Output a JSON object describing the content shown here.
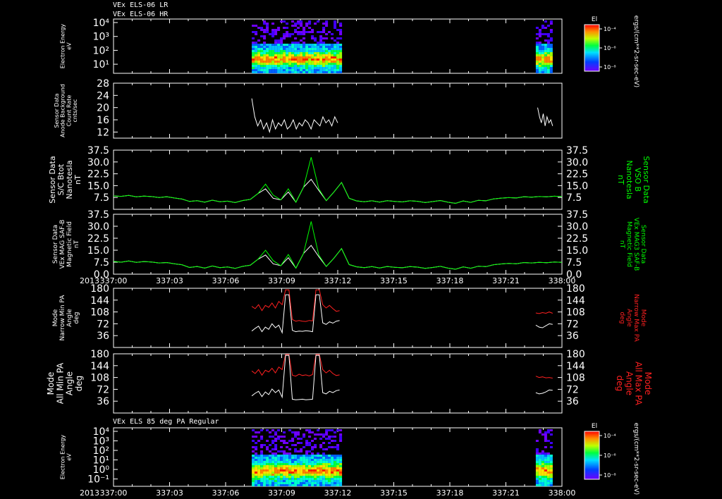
{
  "header": {
    "title_lines": [
      "VEx ELS-06 LR",
      "VEx ELS-06 HR"
    ]
  },
  "bottom_panel_title": "VEx ELS 85 deg PA Regular",
  "colors": {
    "white": "#ffffff",
    "green": "#00ff00",
    "red": "#ff2020",
    "frame": "#ffffff"
  },
  "colorbars": [
    {
      "label": "El",
      "ticks": [
        "10⁻⁴",
        "10⁻⁶",
        "10⁻⁸"
      ],
      "unit": "ergs/(cm**2-sr-sec-eV)"
    },
    {
      "label": "El",
      "ticks": [
        "10⁻⁴",
        "10⁻⁶",
        "10⁻⁸"
      ],
      "unit": "ergs/(cm**2-sr-sec-eV)"
    }
  ],
  "chart_data": [
    {
      "type": "heatmap",
      "ylabel": [
        "Electron Energy",
        "eV"
      ],
      "yticks": [
        "10⁴",
        "10³",
        "10²",
        "10¹"
      ],
      "scale": "log",
      "blocks": [
        {
          "t0": 7.4,
          "t1": 12.1
        },
        {
          "t0": 22.6,
          "t1": 23.5
        }
      ]
    },
    {
      "type": "line",
      "ylabel": [
        "Sensor Data",
        "Anode Background",
        "Count Rate",
        "cnts/sec"
      ],
      "yticks": [
        "28",
        "24",
        "20",
        "16",
        "12"
      ],
      "ylim": [
        10,
        28
      ],
      "series": [
        {
          "color": "white",
          "segments": [
            {
              "t0": 7.4,
              "t1": 12.0,
              "values": [
                23,
                17,
                14,
                16,
                13,
                15,
                12,
                16,
                13,
                15,
                14,
                16,
                13,
                14,
                16,
                13,
                15,
                14,
                16,
                15,
                13,
                16,
                15,
                14,
                17,
                15,
                16,
                14,
                17,
                15
              ]
            },
            {
              "t0": 22.7,
              "t1": 23.5,
              "values": [
                20,
                17,
                15,
                18,
                14,
                17,
                15,
                16,
                14
              ]
            }
          ]
        }
      ]
    },
    {
      "type": "line",
      "ylabel": [
        "Sensor Data",
        "S/C Btot",
        "Nanotesla",
        "nT"
      ],
      "ylabel_right": [
        "Sensor Data",
        "VSO B",
        "Nanotesla",
        "nT"
      ],
      "yticks": [
        "37.5",
        "30.0",
        "22.5",
        "15.0",
        "7.5"
      ],
      "ylim": [
        0,
        37.5
      ],
      "series": [
        {
          "color": "white",
          "values": [
            8.5,
            8.2,
            8.8,
            7.9,
            8.4,
            8.1,
            7.5,
            8,
            7.2,
            6.5,
            5,
            5.5,
            4.5,
            5.8,
            4.8,
            5.2,
            4.3,
            5.6,
            6.3,
            10,
            13,
            7,
            6,
            11,
            4.5,
            14,
            19,
            12,
            5.5,
            11,
            17,
            7,
            5.3,
            4.8,
            5.4,
            4.6,
            5.5,
            5,
            4.7,
            5.4,
            5.1,
            4.3,
            4.9,
            5.6,
            4.5,
            3.8,
            5.3,
            4.4,
            5.7,
            5.4,
            6.6,
            7.1,
            7.4,
            7.2,
            8,
            7.7,
            8.1,
            7.9,
            8.3,
            8.1
          ]
        },
        {
          "color": "green",
          "values": [
            8.5,
            8.2,
            8.8,
            7.9,
            8.4,
            8.1,
            7.5,
            8,
            7.2,
            6.5,
            5,
            5.5,
            4.5,
            5.8,
            4.8,
            5.2,
            4.3,
            5.6,
            6.3,
            10,
            16,
            9,
            6,
            13,
            4.5,
            14,
            33,
            13,
            5.5,
            11,
            17,
            7,
            5.3,
            4.8,
            5.4,
            4.6,
            5.5,
            5,
            4.7,
            5.4,
            5.1,
            4.3,
            4.9,
            5.6,
            4.5,
            3.8,
            5.3,
            4.4,
            5.7,
            5.4,
            6.6,
            7.1,
            7.4,
            7.2,
            8,
            7.7,
            8.1,
            7.9,
            8.3,
            8.1
          ]
        }
      ]
    },
    {
      "type": "line",
      "ylabel": [
        "Sensor Data",
        "VEx MAG SAF-B",
        "Magnetic Field",
        "nT"
      ],
      "ylabel_right": [
        "Sensor Data",
        "VEx MAG3 SAF-B",
        "Magnetic Field",
        "nT"
      ],
      "yticks": [
        "37.5",
        "30.0",
        "22.5",
        "15.0",
        "7.5",
        "0.0"
      ],
      "ylim": [
        0,
        37.5
      ],
      "series": [
        {
          "color": "white",
          "values": [
            8,
            7.5,
            8.3,
            7.4,
            7.9,
            7.6,
            7,
            7.3,
            6.5,
            5.9,
            4.2,
            4.8,
            3.8,
            5.1,
            4.1,
            4.5,
            3.6,
            4.9,
            5.6,
            9.3,
            12,
            6.5,
            5.3,
            10.3,
            3.8,
            13,
            18,
            11,
            4.8,
            10,
            16,
            6,
            4.6,
            4.1,
            4.7,
            3.9,
            4.8,
            4.3,
            4,
            4.7,
            4.4,
            3.6,
            4.2,
            4.9,
            3.8,
            3.1,
            4.6,
            3.7,
            5,
            4.7,
            5.9,
            6.4,
            6.7,
            6.5,
            7.3,
            7,
            7.4,
            7.2,
            7.6,
            7.4
          ]
        },
        {
          "color": "green",
          "values": [
            8,
            7.5,
            8.3,
            7.4,
            7.9,
            7.6,
            7,
            7.3,
            6.5,
            5.9,
            4.2,
            4.8,
            3.8,
            5.1,
            4.1,
            4.5,
            3.6,
            4.9,
            5.6,
            9.3,
            15,
            8.5,
            5.3,
            12.3,
            3.8,
            13,
            33,
            12,
            4.8,
            10,
            16,
            6,
            4.6,
            4.1,
            4.7,
            3.9,
            4.8,
            4.3,
            4,
            4.7,
            4.4,
            3.6,
            4.2,
            4.9,
            3.8,
            3.1,
            4.6,
            3.7,
            5,
            4.7,
            5.9,
            6.4,
            6.7,
            6.5,
            7.3,
            7,
            7.4,
            7.2,
            7.6,
            7.4
          ]
        }
      ]
    },
    {
      "type": "line",
      "ylabel": [
        "Mode",
        "Narrow Min PA",
        "Angle",
        "deg"
      ],
      "ylabel_right": [
        "Mode",
        "Narrow Max PA",
        "Angle",
        "deg"
      ],
      "yticks": [
        "180",
        "144",
        "108",
        "72",
        "36"
      ],
      "ylim": [
        0,
        180
      ],
      "series": [
        {
          "color": "red",
          "segments": [
            {
              "t0": 7.4,
              "t1": 12.1,
              "values": [
                125,
                118,
                130,
                112,
                128,
                122,
                135,
                120,
                140,
                130,
                175,
                175,
                85,
                80,
                82,
                80,
                79,
                82,
                81,
                175,
                175,
                130,
                120,
                128,
                118,
                110,
                112
              ]
            },
            {
              "t0": 22.6,
              "t1": 23.5,
              "values": [
                105,
                103,
                106,
                104,
                108,
                104
              ]
            }
          ]
        },
        {
          "color": "white",
          "segments": [
            {
              "t0": 7.4,
              "t1": 12.1,
              "values": [
                50,
                58,
                65,
                48,
                62,
                55,
                72,
                60,
                68,
                45,
                160,
                160,
                52,
                48,
                50,
                49,
                51,
                50,
                48,
                160,
                160,
                75,
                70,
                78,
                74,
                80,
                82
              ]
            },
            {
              "t0": 22.6,
              "t1": 23.5,
              "values": [
                68,
                62,
                60,
                66,
                72,
                70
              ]
            }
          ]
        }
      ]
    },
    {
      "type": "line",
      "ylabel": [
        "Mode",
        "All Min PA",
        "Angle",
        "deg"
      ],
      "ylabel_right": [
        "Mode",
        "All Max PA",
        "Angle",
        "deg"
      ],
      "yticks": [
        "180",
        "144",
        "108",
        "72",
        "36"
      ],
      "ylim": [
        0,
        180
      ],
      "series": [
        {
          "color": "red",
          "segments": [
            {
              "t0": 7.4,
              "t1": 12.1,
              "values": [
                128,
                120,
                132,
                115,
                130,
                125,
                136,
                122,
                140,
                132,
                178,
                178,
                115,
                112,
                118,
                114,
                116,
                113,
                117,
                178,
                178,
                132,
                122,
                130,
                120,
                114,
                116
              ]
            },
            {
              "t0": 22.6,
              "t1": 23.5,
              "values": [
                112,
                108,
                110,
                107,
                108,
                106
              ]
            }
          ]
        },
        {
          "color": "white",
          "segments": [
            {
              "t0": 7.4,
              "t1": 12.1,
              "values": [
                52,
                60,
                66,
                50,
                64,
                56,
                73,
                62,
                70,
                48,
                175,
                175,
                42,
                40,
                41,
                42,
                40,
                41,
                42,
                175,
                175,
                62,
                58,
                66,
                62,
                68,
                70
              ]
            },
            {
              "t0": 22.6,
              "t1": 23.5,
              "values": [
                62,
                58,
                60,
                64,
                70,
                69
              ]
            }
          ]
        }
      ]
    },
    {
      "type": "heatmap",
      "ylabel": [
        "Electron Energy",
        "eV"
      ],
      "yticks": [
        "10⁴",
        "10³",
        "10²",
        "10¹",
        "10⁰",
        "10⁻¹"
      ],
      "scale": "log",
      "blocks": [
        {
          "t0": 7.4,
          "t1": 12.1
        },
        {
          "t0": 22.6,
          "t1": 23.5
        }
      ]
    }
  ],
  "time_axis": {
    "year": "2013",
    "ticks": [
      "337:00",
      "337:03",
      "337:06",
      "337:09",
      "337:12",
      "337:15",
      "337:18",
      "337:21",
      "338:00"
    ],
    "range_hours": [
      0,
      24
    ]
  }
}
